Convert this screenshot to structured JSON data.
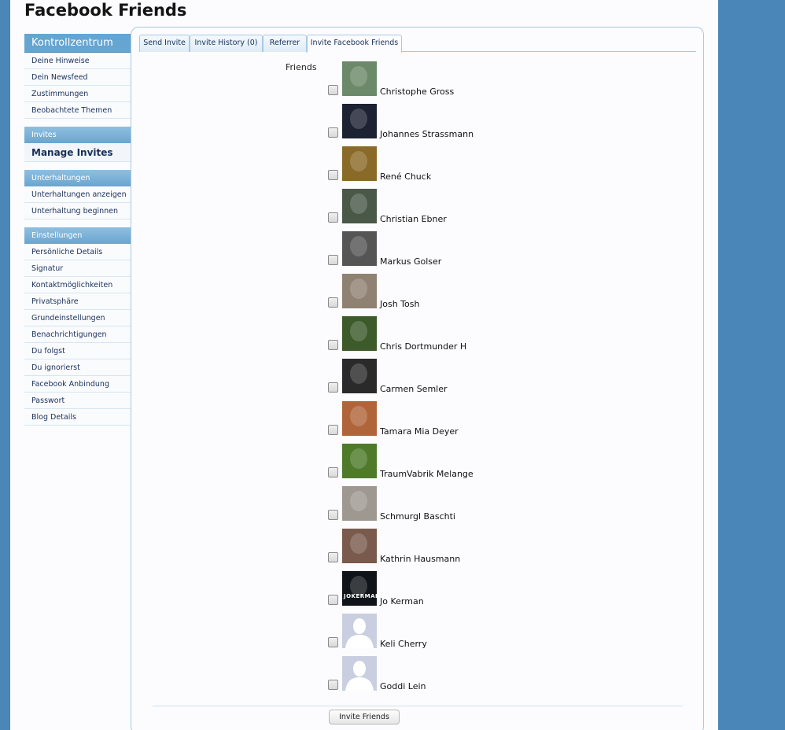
{
  "page": {
    "title": "Facebook Friends"
  },
  "sidebar": {
    "header": "Kontrollzentrum",
    "main_items": [
      "Deine Hinweise",
      "Dein Newsfeed",
      "Zustimmungen",
      "Beobachtete Themen"
    ],
    "groups": [
      {
        "title": "Invites",
        "items": [
          {
            "label": "Manage Invites",
            "big": true
          }
        ]
      },
      {
        "title": "Unterhaltungen",
        "items": [
          {
            "label": "Unterhaltungen anzeigen"
          },
          {
            "label": "Unterhaltung beginnen"
          }
        ]
      },
      {
        "title": "Einstellungen",
        "items": [
          {
            "label": "Persönliche Details"
          },
          {
            "label": "Signatur"
          },
          {
            "label": "Kontaktmöglichkeiten"
          },
          {
            "label": "Privatsphäre"
          },
          {
            "label": "Grundeinstellungen"
          },
          {
            "label": "Benachrichtigungen"
          },
          {
            "label": "Du folgst"
          },
          {
            "label": "Du ignorierst"
          },
          {
            "label": "Facebook Anbindung"
          },
          {
            "label": "Passwort"
          },
          {
            "label": "Blog Details"
          }
        ]
      }
    ]
  },
  "tabs": [
    "Send Invite",
    "Invite History (0)",
    "Referrer",
    "Invite Facebook Friends"
  ],
  "active_tab": "Invite Facebook Friends",
  "form": {
    "friends_label": "Friends",
    "friends": [
      {
        "name": "Christophe Gross",
        "color": "#6c8a6a",
        "icon": "profile-photo"
      },
      {
        "name": "Johannes Strassmann",
        "color": "#1d2233",
        "icon": "profile-photo"
      },
      {
        "name": "René Chuck",
        "color": "#8a6a28",
        "icon": "profile-photo"
      },
      {
        "name": "Christian Ebner",
        "color": "#4a5848",
        "icon": "profile-photo"
      },
      {
        "name": "Markus Golser",
        "color": "#555555",
        "icon": "profile-photo"
      },
      {
        "name": "Josh Tosh",
        "color": "#8f8272",
        "icon": "profile-photo"
      },
      {
        "name": "Chris Dortmunder H",
        "color": "#3c5a2a",
        "icon": "profile-photo"
      },
      {
        "name": "Carmen Semler",
        "color": "#2a2a2a",
        "icon": "profile-photo"
      },
      {
        "name": "Tamara Mia Deyer",
        "color": "#b0643a",
        "icon": "profile-photo"
      },
      {
        "name": "TraumVabrik Melange",
        "color": "#4e7a2a",
        "icon": "profile-photo"
      },
      {
        "name": "Schmurgl Baschti",
        "color": "#9e9890",
        "icon": "profile-photo"
      },
      {
        "name": "Kathrin Hausmann",
        "color": "#7a5a4c",
        "icon": "profile-photo"
      },
      {
        "name": "Jo Kerman",
        "color": "#101418",
        "icon": "profile-photo",
        "photo_text": "JOKERMAN"
      },
      {
        "name": "Keli Cherry",
        "color": "#c9cfe0",
        "icon": "default-avatar"
      },
      {
        "name": "Goddi Lein",
        "color": "#c9cfe0",
        "icon": "default-avatar"
      }
    ],
    "submit_label": "Invite Friends"
  }
}
